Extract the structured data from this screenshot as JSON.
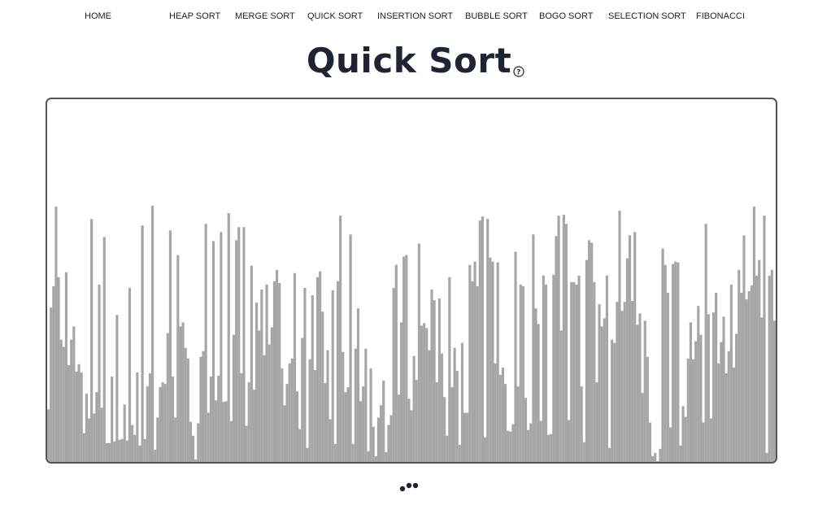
{
  "nav": {
    "items": [
      {
        "label": "HOME",
        "name": "nav-item-home"
      },
      {
        "label": "HEAP SORT",
        "name": "nav-item-heap-sort"
      },
      {
        "label": "MERGE SORT",
        "name": "nav-item-merge-sort"
      },
      {
        "label": "QUICK SORT",
        "name": "nav-item-quick-sort"
      },
      {
        "label": "INSERTION SORT",
        "name": "nav-item-insertion-sort"
      },
      {
        "label": "BUBBLE SORT",
        "name": "nav-item-bubble-sort"
      },
      {
        "label": "BOGO SORT",
        "name": "nav-item-bogo-sort"
      },
      {
        "label": "SELECTION SORT",
        "name": "nav-item-selection-sort"
      },
      {
        "label": "FIBONACCI",
        "name": "nav-item-fibonacci"
      }
    ]
  },
  "page": {
    "title": "Quick Sort",
    "help_icon": "question-circle-icon"
  },
  "visualizer": {
    "bar_color": "#a6a6a6",
    "border_color": "#555555",
    "loading_icon": "loading-dots-icon",
    "values": [
      64,
      188,
      214,
      311,
      225,
      149,
      140,
      231,
      118,
      149,
      165,
      110,
      119,
      109,
      35,
      83,
      53,
      296,
      59,
      85,
      216,
      66,
      274,
      23,
      23,
      104,
      25,
      179,
      27,
      28,
      70,
      26,
      212,
      45,
      33,
      109,
      20,
      288,
      28,
      92,
      108,
      312,
      15,
      54,
      91,
      97,
      95,
      157,
      282,
      104,
      54,
      252,
      165,
      170,
      139,
      126,
      49,
      32,
      3,
      47,
      128,
      135,
      290,
      60,
      104,
      269,
      75,
      105,
      280,
      73,
      74,
      303,
      50,
      155,
      270,
      286,
      108,
      286,
      44,
      97,
      239,
      88,
      194,
      160,
      210,
      130,
      216,
      143,
      164,
      220,
      234,
      218,
      114,
      69,
      95,
      120,
      126,
      230,
      86,
      40,
      151,
      212,
      17,
      125,
      203,
      112,
      225,
      232,
      183,
      96,
      136,
      52,
      209,
      22,
      220,
      300,
      134,
      85,
      91,
      277,
      22,
      138,
      187,
      74,
      92,
      138,
      13,
      114,
      43,
      7,
      54,
      69,
      99,
      12,
      45,
      57,
      212,
      240,
      82,
      170,
      250,
      252,
      77,
      63,
      129,
      100,
      266,
      166,
      169,
      163,
      136,
      210,
      197,
      97,
      199,
      132,
      79,
      32,
      225,
      91,
      139,
      111,
      21,
      145,
      60,
      60,
      240,
      220,
      244,
      214,
      294,
      299,
      30,
      296,
      249,
      244,
      120,
      243,
      106,
      115,
      95,
      38,
      37,
      46,
      256,
      92,
      216,
      214,
      78,
      39,
      47,
      277,
      187,
      168,
      50,
      227,
      216,
      33,
      34,
      228,
      275,
      300,
      160,
      301,
      290,
      51,
      219,
      219,
      216,
      227,
      92,
      24,
      246,
      270,
      267,
      219,
      97,
      192,
      165,
      175,
      227,
      17,
      149,
      145,
      195,
      306,
      184,
      195,
      248,
      276,
      196,
      280,
      167,
      181,
      84,
      172,
      128,
      48,
      7,
      11,
      0,
      16,
      260,
      240,
      206,
      42,
      241,
      244,
      243,
      20,
      68,
      55,
      126,
      170,
      125,
      147,
      190,
      155,
      48,
      290,
      180,
      53,
      182,
      206,
      120,
      146,
      177,
      108,
      135,
      216,
      115,
      156,
      234,
      206,
      276,
      198,
      208,
      215,
      311,
      227,
      246,
      176,
      300,
      11,
      227,
      234,
      172
    ]
  }
}
